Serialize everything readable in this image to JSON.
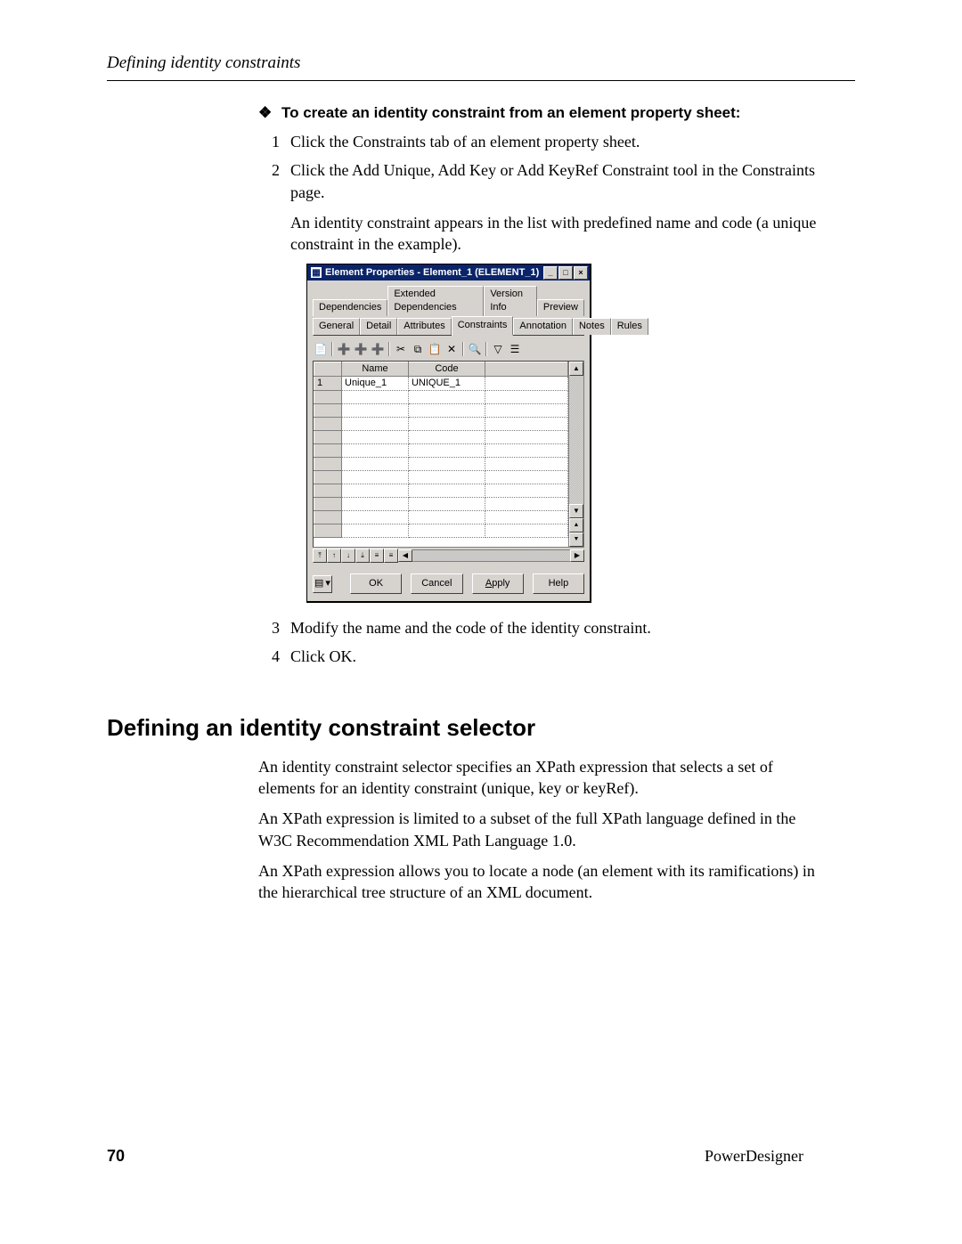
{
  "header": {
    "running_head": "Defining identity constraints"
  },
  "task": {
    "heading": "To create an identity constraint from an element property sheet:",
    "steps": [
      {
        "n": "1",
        "text": "Click the Constraints tab of an element property sheet."
      },
      {
        "n": "2",
        "text": "Click the Add Unique, Add Key or Add KeyRef Constraint tool in the Constraints page."
      }
    ],
    "after_step2": "An identity constraint appears in the list with predefined name and code (a unique constraint in the example).",
    "steps_cont": [
      {
        "n": "3",
        "text": "Modify the name and the code of the identity constraint."
      },
      {
        "n": "4",
        "text": "Click OK."
      }
    ]
  },
  "dialog": {
    "title": "Element Properties - Element_1 (ELEMENT_1)",
    "tabs_top": [
      "Dependencies",
      "Extended Dependencies",
      "Version Info",
      "Preview"
    ],
    "tabs_bottom": [
      "General",
      "Detail",
      "Attributes",
      "Constraints",
      "Annotation",
      "Notes",
      "Rules"
    ],
    "active_tab": "Constraints",
    "columns": [
      "Name",
      "Code"
    ],
    "rows": [
      {
        "n": "1",
        "name": "Unique_1",
        "code": "UNIQUE_1"
      }
    ],
    "buttons": {
      "ok": "OK",
      "cancel": "Cancel",
      "apply": "Apply",
      "help": "Help"
    }
  },
  "section2": {
    "title": "Defining an identity constraint selector",
    "p1": "An identity constraint selector specifies an XPath expression that selects a set of elements for an identity constraint (unique, key or keyRef).",
    "p2": "An XPath expression is limited to a subset of the full XPath language defined in the W3C Recommendation XML Path Language 1.0.",
    "p3": "An XPath expression allows you to locate a node (an element with its ramifications) in the hierarchical tree structure of an XML document."
  },
  "footer": {
    "page": "70",
    "product": "PowerDesigner"
  }
}
